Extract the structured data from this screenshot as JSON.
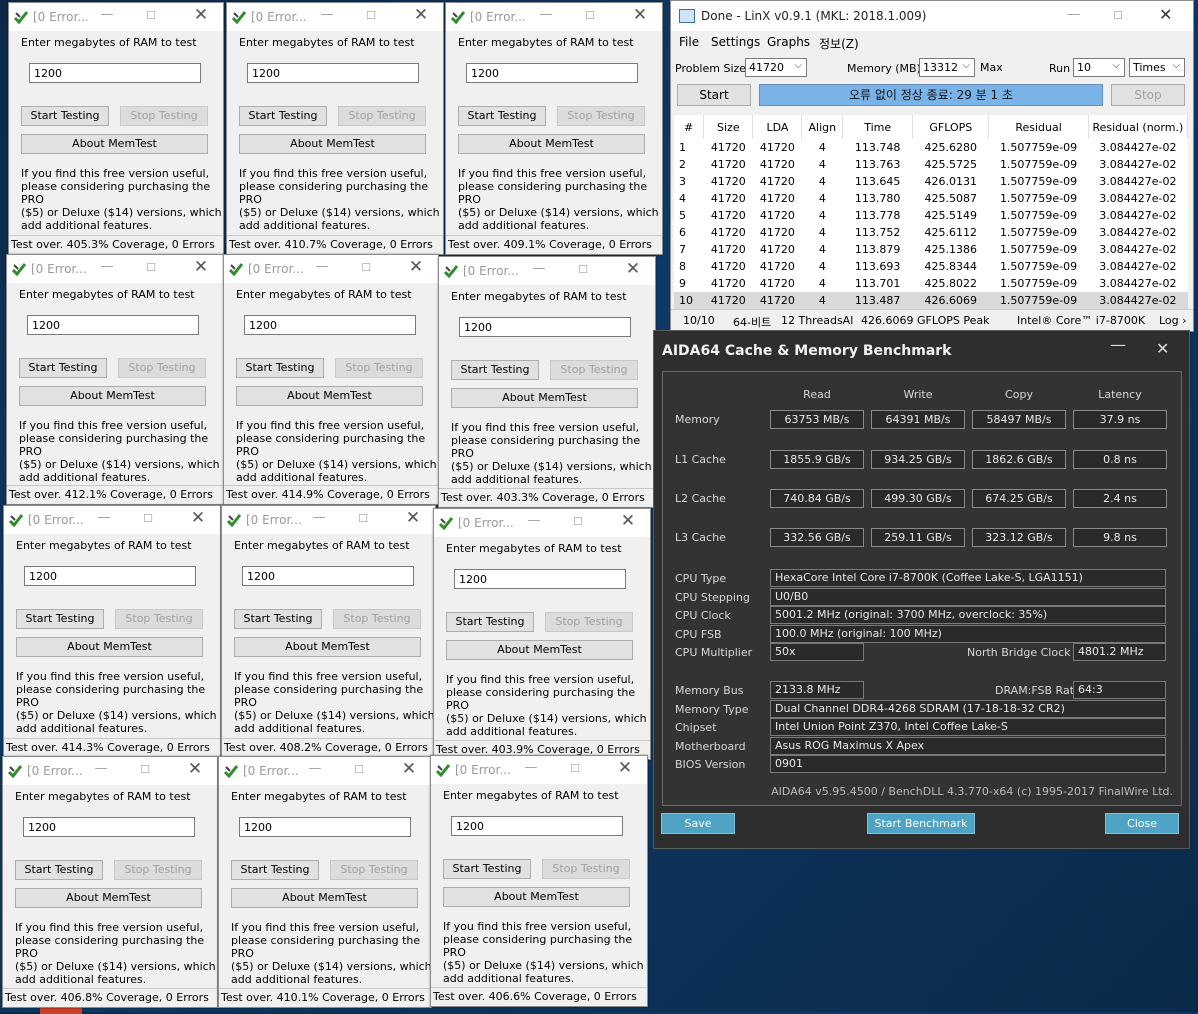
{
  "memtest": {
    "title": "[0 Error...",
    "prompt": "Enter megabytes of RAM to test",
    "ram_value": "1200",
    "start_label": "Start Testing",
    "stop_label": "Stop Testing",
    "about_label": "About MemTest",
    "info_line1": "If you find this free version useful,",
    "info_line2": "please considering purchasing the PRO",
    "info_line3": "($5) or Deluxe ($14) versions, which",
    "info_line4": "add additional features.",
    "windows": [
      {
        "status": "Test over. 405.3% Coverage, 0 Errors"
      },
      {
        "status": "Test over. 410.7% Coverage, 0 Errors"
      },
      {
        "status": "Test over. 409.1% Coverage, 0 Errors"
      },
      {
        "status": "Test over. 412.1% Coverage, 0 Errors"
      },
      {
        "status": "Test over. 414.9% Coverage, 0 Errors"
      },
      {
        "status": "Test over. 403.3% Coverage, 0 Errors"
      },
      {
        "status": "Test over. 414.3% Coverage, 0 Errors"
      },
      {
        "status": "Test over. 408.2% Coverage, 0 Errors"
      },
      {
        "status": "Test over. 403.9% Coverage, 0 Errors"
      },
      {
        "status": "Test over. 406.8% Coverage, 0 Errors"
      },
      {
        "status": "Test over. 410.1% Coverage, 0 Errors"
      },
      {
        "status": "Test over. 406.6% Coverage, 0 Errors"
      }
    ]
  },
  "linx": {
    "title": "Done - LinX v0.9.1 (MKL: 2018.1.009)",
    "menu": [
      "File",
      "Settings",
      "Graphs",
      "정보(Z)"
    ],
    "problem_size_label": "Problem Size:",
    "problem_size": "41720",
    "memory_label": "Memory (MB):",
    "memory": "13312",
    "max_label": "Max",
    "run_label": "Run",
    "run": "10",
    "times": "Times",
    "start_label": "Start",
    "progress_text": "오류 없이 정상 종료: 29 분 1 초",
    "stop_label": "Stop",
    "columns": [
      "#",
      "Size",
      "LDA",
      "Align",
      "Time",
      "GFLOPS",
      "Residual",
      "Residual (norm.)"
    ],
    "rows": [
      [
        "1",
        "41720",
        "41720",
        "4",
        "113.748",
        "425.6280",
        "1.507759e-09",
        "3.084427e-02"
      ],
      [
        "2",
        "41720",
        "41720",
        "4",
        "113.763",
        "425.5725",
        "1.507759e-09",
        "3.084427e-02"
      ],
      [
        "3",
        "41720",
        "41720",
        "4",
        "113.645",
        "426.0131",
        "1.507759e-09",
        "3.084427e-02"
      ],
      [
        "4",
        "41720",
        "41720",
        "4",
        "113.780",
        "425.5087",
        "1.507759e-09",
        "3.084427e-02"
      ],
      [
        "5",
        "41720",
        "41720",
        "4",
        "113.778",
        "425.5149",
        "1.507759e-09",
        "3.084427e-02"
      ],
      [
        "6",
        "41720",
        "41720",
        "4",
        "113.752",
        "425.6112",
        "1.507759e-09",
        "3.084427e-02"
      ],
      [
        "7",
        "41720",
        "41720",
        "4",
        "113.879",
        "425.1386",
        "1.507759e-09",
        "3.084427e-02"
      ],
      [
        "8",
        "41720",
        "41720",
        "4",
        "113.693",
        "425.8344",
        "1.507759e-09",
        "3.084427e-02"
      ],
      [
        "9",
        "41720",
        "41720",
        "4",
        "113.701",
        "425.8022",
        "1.507759e-09",
        "3.084427e-02"
      ],
      [
        "10",
        "41720",
        "41720",
        "4",
        "113.487",
        "426.6069",
        "1.507759e-09",
        "3.084427e-02"
      ]
    ],
    "status": {
      "runs": "10/10",
      "bits": "64-비트",
      "threads": "12 ThreadsAl",
      "peak": "426.6069 GFLOPS Peak",
      "cpu": "Intel® Core™ i7-8700K",
      "log": "Log ›"
    }
  },
  "aida": {
    "title": "AIDA64 Cache & Memory Benchmark",
    "headers": [
      "Read",
      "Write",
      "Copy",
      "Latency"
    ],
    "bench": [
      {
        "label": "Memory",
        "read": "63753 MB/s",
        "write": "64391 MB/s",
        "copy": "58497 MB/s",
        "latency": "37.9 ns"
      },
      {
        "label": "L1 Cache",
        "read": "1855.9 GB/s",
        "write": "934.25 GB/s",
        "copy": "1862.6 GB/s",
        "latency": "0.8 ns"
      },
      {
        "label": "L2 Cache",
        "read": "740.84 GB/s",
        "write": "499.30 GB/s",
        "copy": "674.25 GB/s",
        "latency": "2.4 ns"
      },
      {
        "label": "L3 Cache",
        "read": "332.56 GB/s",
        "write": "259.11 GB/s",
        "copy": "323.12 GB/s",
        "latency": "9.8 ns"
      }
    ],
    "cpu_type_label": "CPU Type",
    "cpu_type": "HexaCore Intel Core i7-8700K  (Coffee Lake-S, LGA1151)",
    "cpu_stepping_label": "CPU Stepping",
    "cpu_stepping": "U0/B0",
    "cpu_clock_label": "CPU Clock",
    "cpu_clock": "5001.2 MHz  (original: 3700 MHz, overclock: 35%)",
    "cpu_fsb_label": "CPU FSB",
    "cpu_fsb": "100.0 MHz  (original: 100 MHz)",
    "cpu_mult_label": "CPU Multiplier",
    "cpu_mult": "50x",
    "nb_clock_label": "North Bridge Clock",
    "nb_clock": "4801.2 MHz",
    "mem_bus_label": "Memory Bus",
    "mem_bus": "2133.8 MHz",
    "dram_ratio_label": "DRAM:FSB Ratio",
    "dram_ratio": "64:3",
    "mem_type_label": "Memory Type",
    "mem_type": "Dual Channel DDR4-4268 SDRAM  (17-18-18-32 CR2)",
    "chipset_label": "Chipset",
    "chipset": "Intel Union Point Z370, Intel Coffee Lake-S",
    "mobo_label": "Motherboard",
    "mobo": "Asus ROG Maximus X Apex",
    "bios_label": "BIOS Version",
    "bios": "0901",
    "footer": "AIDA64 v5.95.4500 / BenchDLL 4.3.770-x64  (c) 1995-2017 FinalWire Ltd.",
    "save_label": "Save",
    "start_label": "Start Benchmark",
    "close_label": "Close"
  }
}
